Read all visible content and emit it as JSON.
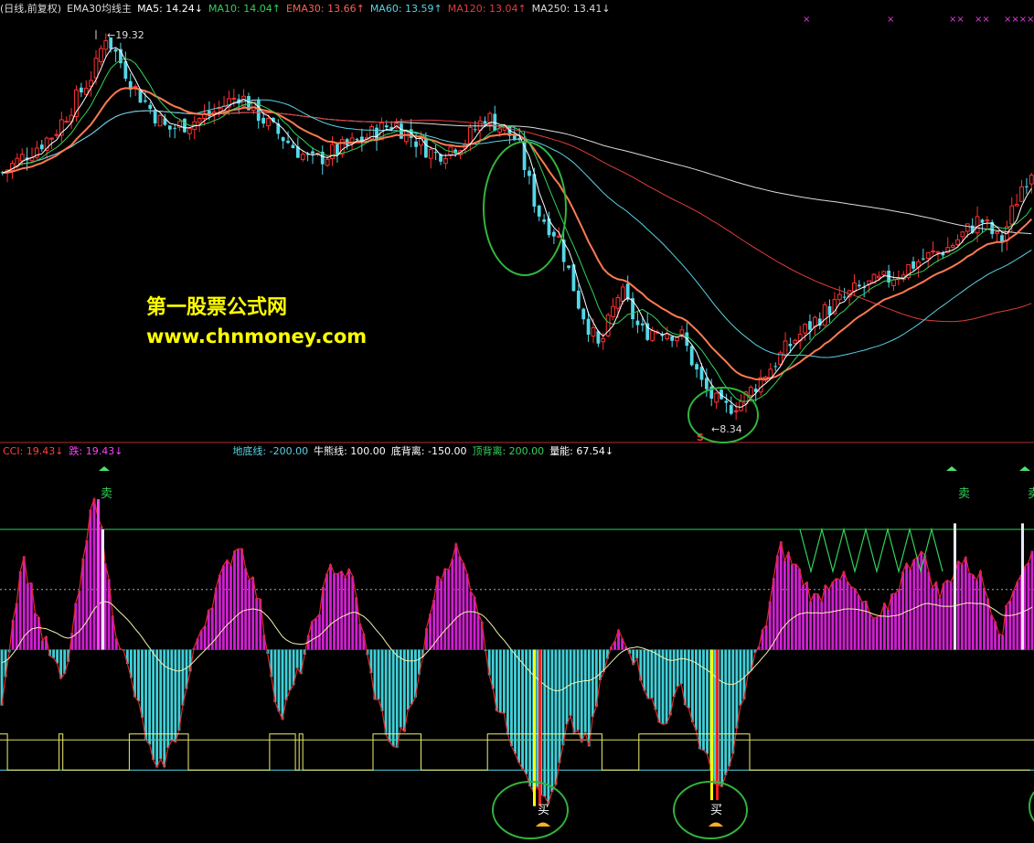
{
  "top_panel": {
    "legend": [
      {
        "text": "(日线,前复权)",
        "color": "#dcdcdc"
      },
      {
        "text": "EMA30均线主",
        "color": "#dcdcdc"
      },
      {
        "text": "MA5: 14.24↓",
        "color": "#ffffff"
      },
      {
        "text": "MA10: 14.04↑",
        "color": "#32d25a"
      },
      {
        "text": "EMA30: 13.66↑",
        "color": "#ff6050"
      },
      {
        "text": "MA60: 13.59↑",
        "color": "#5ad2e6"
      },
      {
        "text": "MA120: 13.04↑",
        "color": "#e03c3c"
      },
      {
        "text": "MA250: 13.41↓",
        "color": "#dcdcdc"
      }
    ],
    "high_label": "19.32",
    "low_label": "8.34",
    "signal_mark": "S",
    "x_marks": [
      "×",
      "×",
      "××",
      "××",
      "×××",
      "××"
    ]
  },
  "watermark": {
    "line1": "第一股票公式网",
    "line2": "www.chnmoney.com"
  },
  "bottom_panel": {
    "legend": [
      {
        "text": "CCI: 19.43↓",
        "color": "#ff4040"
      },
      {
        "text": "跌: 19.43↓",
        "color": "#ff40ff"
      },
      {
        "text": "地底线: -200.00",
        "color": "#5ad2e6"
      },
      {
        "text": "牛熊线: 100.00",
        "color": "#ffffff"
      },
      {
        "text": "底背离: -150.00",
        "color": "#ffffff"
      },
      {
        "text": "顶背离: 200.00",
        "color": "#32d25a"
      },
      {
        "text": "量能: 67.54↓",
        "color": "#ffffff"
      }
    ],
    "sell_label": "卖",
    "buy_label": "买"
  },
  "chart_data": [
    {
      "type": "candlestick",
      "title": "EMA30均线主",
      "ylim": [
        8.0,
        19.6
      ],
      "series": [
        {
          "name": "MA5",
          "last": 14.24,
          "color": "#ffffff"
        },
        {
          "name": "MA10",
          "last": 14.04,
          "color": "#32d25a"
        },
        {
          "name": "EMA30",
          "last": 13.66,
          "color": "#ff7a50"
        },
        {
          "name": "MA60",
          "last": 13.59,
          "color": "#5ad2e6"
        },
        {
          "name": "MA120",
          "last": 13.04,
          "color": "#e03c3c"
        },
        {
          "name": "MA250",
          "last": 13.41,
          "color": "#dcdcdc"
        }
      ],
      "price_path": [
        [
          0,
          15.3
        ],
        [
          0.05,
          16.4
        ],
        [
          0.09,
          18.2
        ],
        [
          0.1,
          19.2
        ],
        [
          0.13,
          17.6
        ],
        [
          0.16,
          16.5
        ],
        [
          0.2,
          16.9
        ],
        [
          0.23,
          17.5
        ],
        [
          0.26,
          16.6
        ],
        [
          0.3,
          15.6
        ],
        [
          0.34,
          16.1
        ],
        [
          0.38,
          16.7
        ],
        [
          0.42,
          15.8
        ],
        [
          0.45,
          16.2
        ],
        [
          0.47,
          16.9
        ],
        [
          0.5,
          16.2
        ],
        [
          0.52,
          14.2
        ],
        [
          0.54,
          13.5
        ],
        [
          0.56,
          11.6
        ],
        [
          0.58,
          10.3
        ],
        [
          0.6,
          12.0
        ],
        [
          0.62,
          10.8
        ],
        [
          0.64,
          10.9
        ],
        [
          0.66,
          10.7
        ],
        [
          0.68,
          9.3
        ],
        [
          0.7,
          8.6
        ],
        [
          0.72,
          8.9
        ],
        [
          0.74,
          9.6
        ],
        [
          0.77,
          10.6
        ],
        [
          0.8,
          11.4
        ],
        [
          0.83,
          12.0
        ],
        [
          0.86,
          12.3
        ],
        [
          0.89,
          12.8
        ],
        [
          0.92,
          13.2
        ],
        [
          0.95,
          14.0
        ],
        [
          0.97,
          13.3
        ],
        [
          0.99,
          14.9
        ],
        [
          1.0,
          15.4
        ]
      ],
      "high": 19.32,
      "low": 8.34
    },
    {
      "type": "bar",
      "title": "CCI",
      "ylim": [
        -300,
        320
      ],
      "reference_lines": [
        {
          "name": "地底线",
          "value": -200,
          "color": "#5ad2e6"
        },
        {
          "name": "牛熊线",
          "value": 100,
          "color": "#ffffff"
        },
        {
          "name": "底背离",
          "value": -150,
          "color": "#ffffff"
        },
        {
          "name": "顶背离",
          "value": 200,
          "color": "#32d25a"
        }
      ],
      "cci_path": [
        [
          0,
          -80
        ],
        [
          0.02,
          160
        ],
        [
          0.04,
          20
        ],
        [
          0.06,
          -60
        ],
        [
          0.08,
          150
        ],
        [
          0.09,
          270
        ],
        [
          0.11,
          40
        ],
        [
          0.13,
          -80
        ],
        [
          0.15,
          -210
        ],
        [
          0.17,
          -140
        ],
        [
          0.19,
          20
        ],
        [
          0.21,
          110
        ],
        [
          0.23,
          180
        ],
        [
          0.25,
          80
        ],
        [
          0.27,
          -120
        ],
        [
          0.29,
          -30
        ],
        [
          0.32,
          140
        ],
        [
          0.34,
          120
        ],
        [
          0.36,
          -60
        ],
        [
          0.38,
          -170
        ],
        [
          0.4,
          -90
        ],
        [
          0.42,
          100
        ],
        [
          0.44,
          170
        ],
        [
          0.46,
          90
        ],
        [
          0.48,
          -90
        ],
        [
          0.5,
          -170
        ],
        [
          0.52,
          -240
        ],
        [
          0.535,
          -250
        ],
        [
          0.55,
          -120
        ],
        [
          0.57,
          -160
        ],
        [
          0.58,
          -60
        ],
        [
          0.6,
          40
        ],
        [
          0.62,
          -40
        ],
        [
          0.64,
          -130
        ],
        [
          0.66,
          -60
        ],
        [
          0.68,
          -170
        ],
        [
          0.7,
          -240
        ],
        [
          0.71,
          -170
        ],
        [
          0.72,
          -70
        ],
        [
          0.74,
          30
        ],
        [
          0.755,
          170
        ],
        [
          0.77,
          140
        ],
        [
          0.79,
          80
        ],
        [
          0.81,
          130
        ],
        [
          0.83,
          90
        ],
        [
          0.85,
          40
        ],
        [
          0.87,
          110
        ],
        [
          0.89,
          170
        ],
        [
          0.91,
          90
        ],
        [
          0.93,
          150
        ],
        [
          0.95,
          120
        ],
        [
          0.97,
          30
        ],
        [
          0.985,
          120
        ],
        [
          1.0,
          160
        ]
      ],
      "last": 19.43,
      "volume_energy": 67.54
    }
  ]
}
